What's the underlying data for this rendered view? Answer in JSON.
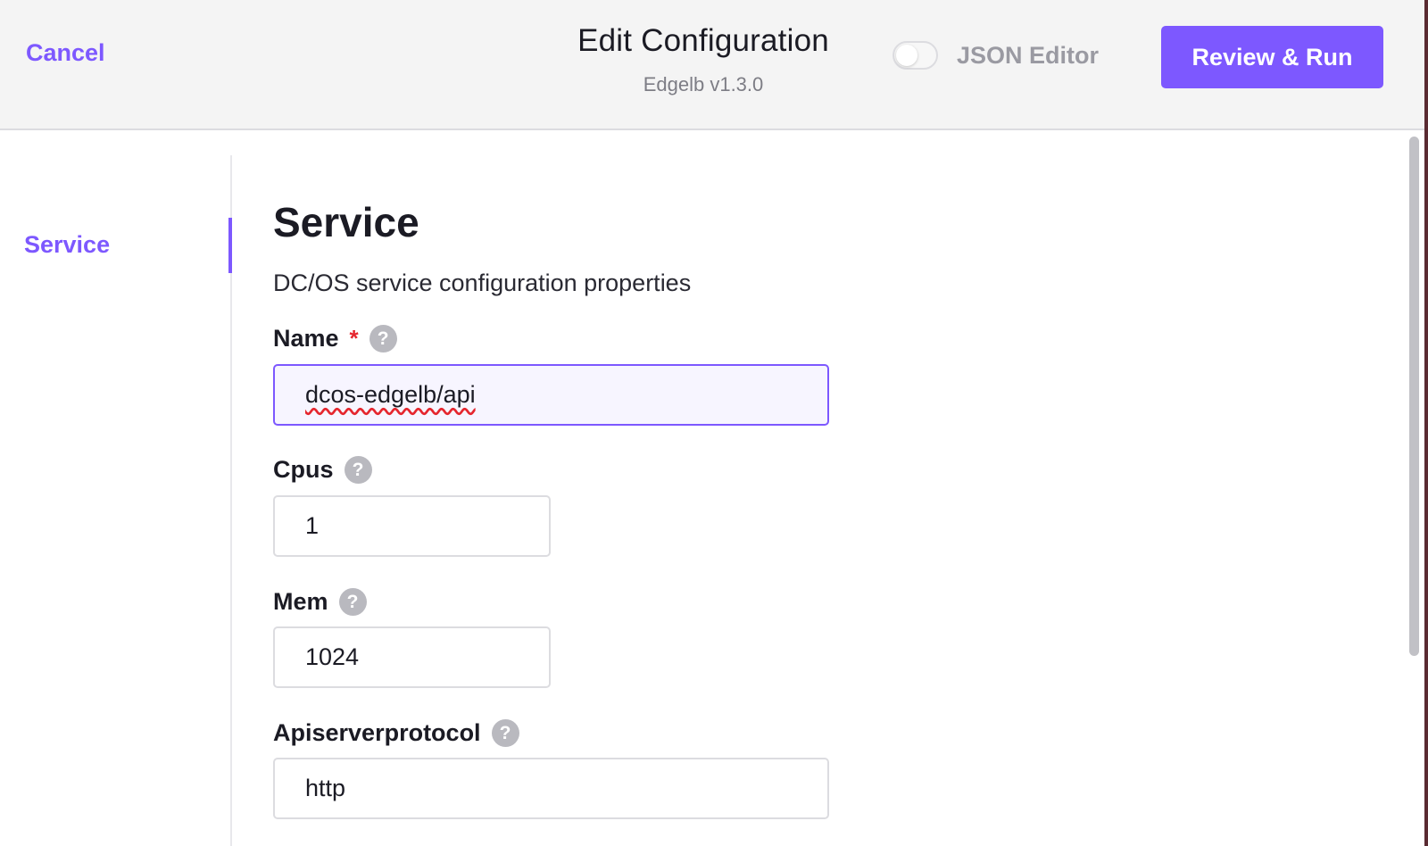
{
  "header": {
    "cancel_label": "Cancel",
    "title": "Edit Configuration",
    "subtitle": "Edgelb v1.3.0",
    "json_editor_label": "JSON Editor",
    "json_editor_enabled": false,
    "primary_button_label": "Review & Run"
  },
  "sidebar": {
    "items": [
      {
        "label": "Service",
        "active": true
      }
    ]
  },
  "main": {
    "section_title": "Service",
    "section_description": "DC/OS service configuration properties",
    "fields": {
      "name": {
        "label": "Name",
        "required_marker": "*",
        "value": "dcos-edgelb/api",
        "help": "?"
      },
      "cpus": {
        "label": "Cpus",
        "value": "1",
        "help": "?"
      },
      "mem": {
        "label": "Mem",
        "value": "1024",
        "help": "?"
      },
      "apiserverprotocol": {
        "label": "Apiserverprotocol",
        "value": "http",
        "help": "?"
      }
    }
  },
  "colors": {
    "accent": "#7d58ff",
    "required": "#e5262e",
    "header_bg": "#f4f4f4"
  }
}
